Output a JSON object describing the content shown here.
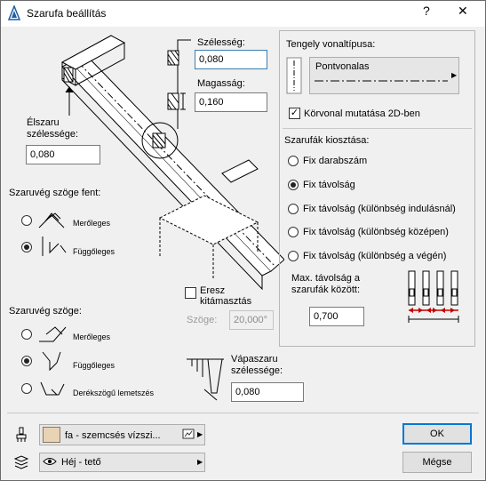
{
  "window": {
    "title": "Szarufa beállítás",
    "help": "?",
    "close": "✕"
  },
  "width_section": {
    "label": "Szélesség:",
    "value": "0,080"
  },
  "height_section": {
    "label": "Magasság:",
    "value": "0,160"
  },
  "eaves_width": {
    "label_line1": "Élszaru",
    "label_line2": "szélessége:",
    "value": "0,080"
  },
  "angle_top": {
    "label": "Szaruvég szöge fent:",
    "options": [
      {
        "label": "Merőleges",
        "selected": false
      },
      {
        "label": "Függőleges",
        "selected": true
      }
    ]
  },
  "angle_bottom": {
    "label": "Szaruvég szöge:",
    "options": [
      {
        "label": "Merőleges",
        "selected": false
      },
      {
        "label": "Függőleges",
        "selected": true
      },
      {
        "label": "Derékszögű lemetszés",
        "selected": false
      }
    ]
  },
  "overhang": {
    "checkbox_line1": "Eresz",
    "checkbox_line2": "kitámasztás",
    "checked": false,
    "angle_label": "Szöge:",
    "angle_value": "20,000°"
  },
  "valley_width": {
    "label_line1": "Vápaszaru",
    "label_line2": "szélessége:",
    "value": "0,080"
  },
  "axis": {
    "label": "Tengely vonaltípusa:",
    "linetype": "Pontvonalas",
    "show_outline": "Körvonal mutatása 2D-ben",
    "show_outline_checked": true
  },
  "distribution": {
    "label": "Szarufák kiosztása:",
    "options": [
      {
        "label": "Fix darabszám",
        "selected": false
      },
      {
        "label": "Fix távolság",
        "selected": true
      },
      {
        "label": "Fix távolság (különbség indulásnál)",
        "selected": false
      },
      {
        "label": "Fix távolság (különbség középen)",
        "selected": false
      },
      {
        "label": "Fix távolság (különbség a végén)",
        "selected": false
      }
    ],
    "max_label_line1": "Max. távolság a",
    "max_label_line2": "szarufák között:",
    "max_value": "0,700"
  },
  "footer": {
    "material": "fa - szemcsés vízszi...",
    "layer": "Héj - tető",
    "ok": "OK",
    "cancel": "Mégse"
  },
  "colors": {
    "accent": "#0078d7",
    "material_swatch": "#e8d3b4",
    "dim_red": "#c00000"
  }
}
